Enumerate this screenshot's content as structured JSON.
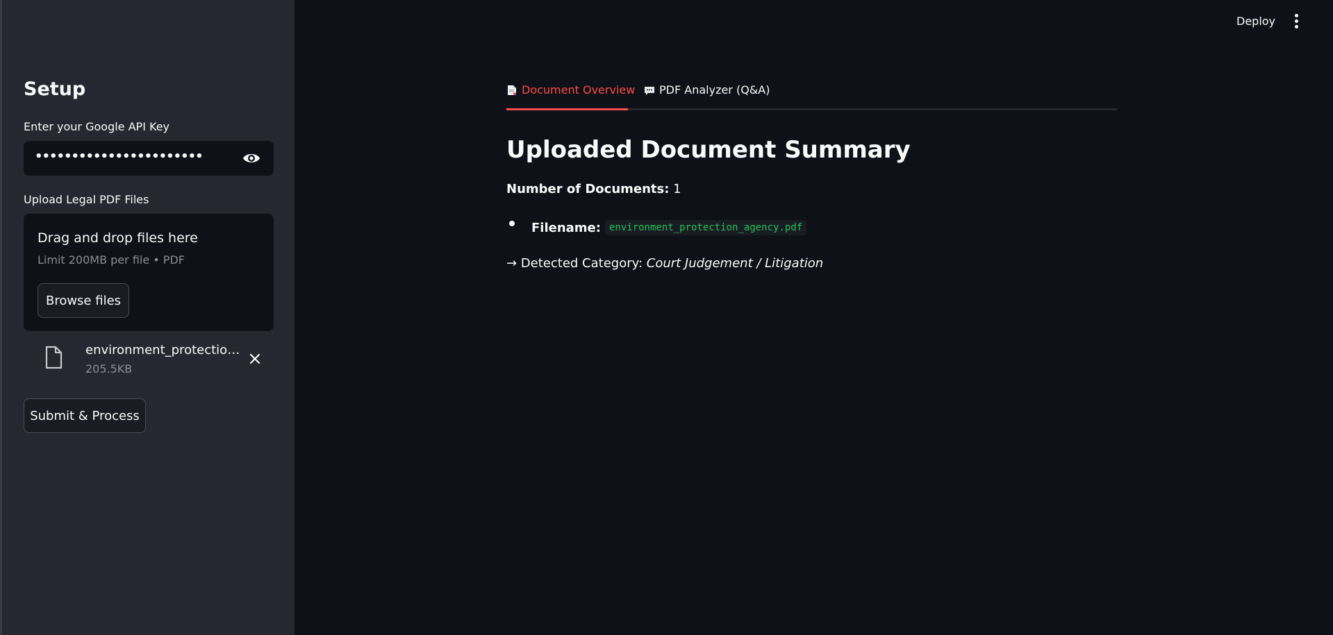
{
  "topbar": {
    "deploy_label": "Deploy",
    "menu_icon": "kebab-menu-icon"
  },
  "sidebar": {
    "title": "Setup",
    "api_key_label": "Enter your Google API Key",
    "api_key_value": "•••••••••••••••••••••••••••••••••••••",
    "upload_label": "Upload Legal PDF Files",
    "dropzone": {
      "title": "Drag and drop files here",
      "limit": "Limit 200MB per file • PDF",
      "browse_label": "Browse files"
    },
    "file": {
      "name": "environment_protection_agency.pdf",
      "size": "205.5KB"
    },
    "submit_label": "Submit & Process"
  },
  "tabs": [
    {
      "label": "Document Overview",
      "icon": "page-facing-up-icon",
      "active": true
    },
    {
      "label": "PDF Analyzer (Q&A)",
      "icon": "speech-balloon-icon",
      "active": false
    }
  ],
  "main": {
    "heading": "Uploaded Document Summary",
    "num_docs_label": "Number of Documents:",
    "num_docs_value": "1",
    "filename_label": "Filename:",
    "filename_value": "environment_protection_agency.pdf",
    "category_prefix": "→ Detected Category: ",
    "category_value": "Court Judgement / Litigation"
  },
  "colors": {
    "accent": "#ff4b4b",
    "code": "#21c354",
    "sidebar_bg": "#262730",
    "main_bg": "#0e1117"
  }
}
